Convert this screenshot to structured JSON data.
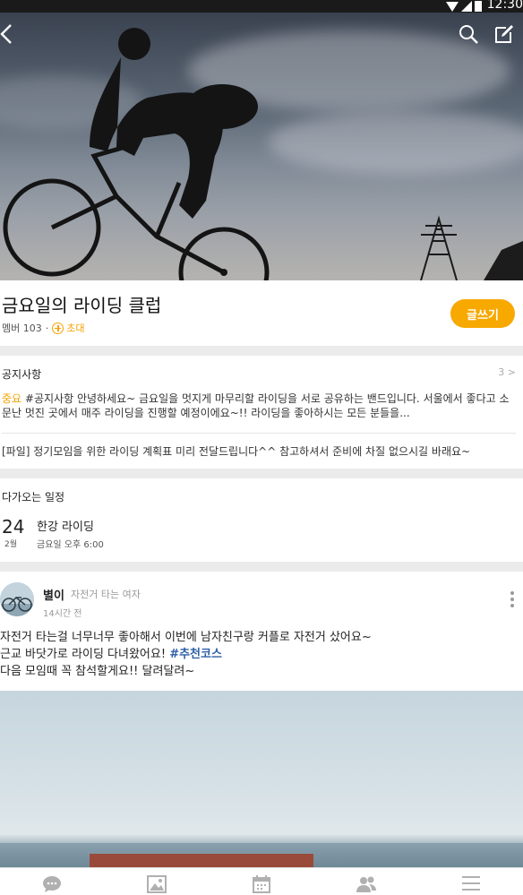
{
  "status_bar": {
    "time": "12:30"
  },
  "band": {
    "title": "금요일의 라이딩 클럽",
    "member_text": "멤버 103",
    "separator": "·",
    "invite_label": "초대",
    "write_button": "글쓰기"
  },
  "notice": {
    "title": "공지사항",
    "count": "3 >",
    "important_label": "중요",
    "text": " #공지사항 안녕하세요~ 금요일을 멋지게 마무리할 라이딩을 서로 공유하는 밴드입니다. 서울에서 좋다고 소문난 멋진 곳에서 매주 라이딩을 진행할 예정이에요~!! 라이딩을 좋아하시는 모든 분들을...",
    "file_item": "[파일] 정기모임을 위한 라이딩 계획표 미리 전달드립니다^^ 참고하셔서 준비에 차질 없으시길 바래요~"
  },
  "schedule": {
    "title": "다가오는 일정",
    "day": "24",
    "month": "2월",
    "event_title": "한강 라이딩",
    "event_time": "금요일 오후 6:00"
  },
  "post": {
    "author": "별이",
    "author_desc": "자전거 타는 여자",
    "time": "14시간 전",
    "line1": "자전거 타는걸 너무너무 좋아해서 이번에 남자친구랑 커플로 자전거 샀어요~",
    "line2": "근교 바닷가로 라이딩 다녀왔어요! ",
    "hashtag": "#추천코스",
    "line3": "다음 모임때 꼭 참석할게요!! 달려달려~"
  },
  "icons": {
    "back": "back-arrow-icon",
    "search": "search-icon",
    "edit": "edit-icon",
    "more": "more-vertical-icon",
    "tabs": [
      "chat-bubble-icon",
      "photo-icon",
      "calendar-icon",
      "members-icon",
      "menu-icon"
    ]
  },
  "colors": {
    "accent": "#f7a900",
    "hashtag": "#2e5fa8"
  }
}
